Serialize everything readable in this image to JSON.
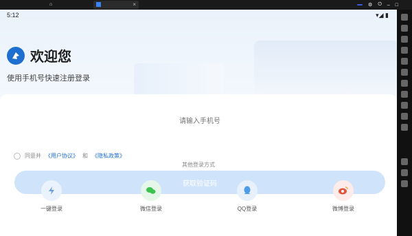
{
  "window": {
    "tabs": [
      {
        "label": ""
      },
      {
        "label": ""
      }
    ],
    "top_pill": "",
    "close_glyph": "×"
  },
  "status": {
    "time": "5:12"
  },
  "header": {
    "title": "欢迎您",
    "subtitle": "使用手机号快速注册登录"
  },
  "login": {
    "phone_placeholder": "请输入手机号",
    "agreement_prefix": "同意并",
    "agreement_link1": "《用户协议》",
    "agreement_mid": "和",
    "agreement_link2": "《隐私政策》",
    "other_methods": "其他登录方式",
    "submit_label": "获取验证码",
    "options": [
      {
        "label": "一键登录",
        "icon": "bolt-icon"
      },
      {
        "label": "微信登录",
        "icon": "wechat-icon"
      },
      {
        "label": "QQ登录",
        "icon": "qq-icon"
      },
      {
        "label": "微博登录",
        "icon": "weibo-icon"
      }
    ]
  },
  "colors": {
    "brand": "#1f6fd0",
    "button": "#cfe4fb"
  }
}
